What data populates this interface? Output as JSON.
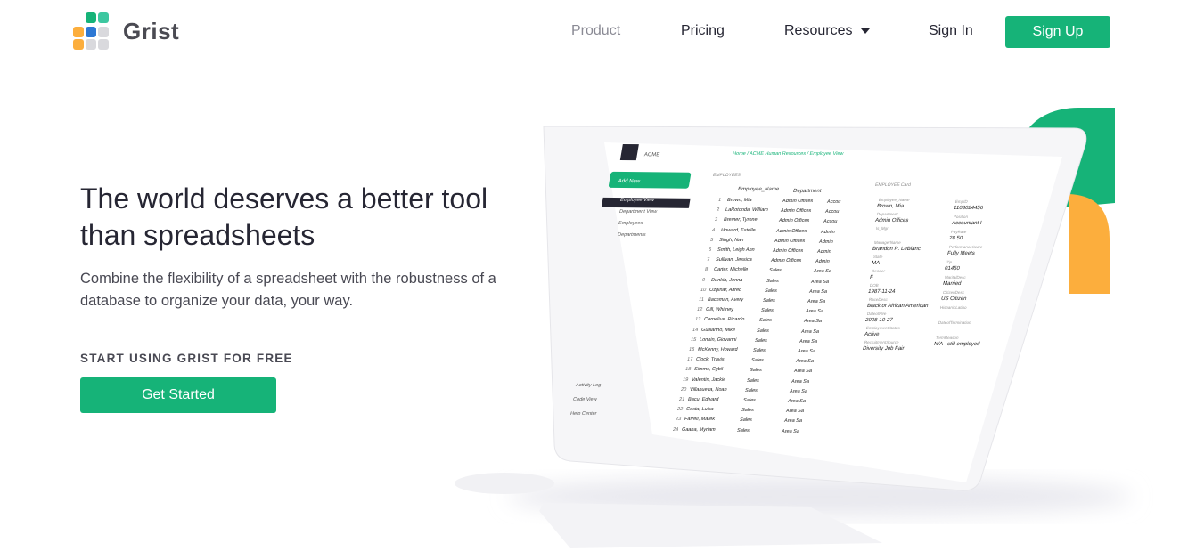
{
  "nav": {
    "logo_text": "Grist",
    "links": [
      {
        "label": "Product"
      },
      {
        "label": "Pricing"
      },
      {
        "label": "Resources"
      },
      {
        "label": "Sign In"
      }
    ],
    "signup_label": "Sign Up"
  },
  "hero": {
    "title": "The world deserves a better tool than spreadsheets",
    "subtitle": "Combine the flexibility of a spreadsheet with the robustness of a database to organize your data, your way.",
    "cta_label": "START USING GRIST FOR FREE",
    "cta_button": "Get Started"
  },
  "mockup": {
    "org": "ACME",
    "add_new": "Add New",
    "breadcrumb": "Home / ACME Human Resources / Employee View",
    "pages": [
      "Employee View",
      "Department View",
      "Employees",
      "Departments"
    ],
    "tools": [
      "Activity Log",
      "Code View",
      "Help Center"
    ],
    "table_title": "EMPLOYEES",
    "card_title": "EMPLOYEE Card",
    "columns": [
      "Employee_Name",
      "Department"
    ],
    "rows": [
      {
        "n": "1",
        "name": "Brown, Mia",
        "dept": "Admin Offices",
        "x": "Accou"
      },
      {
        "n": "2",
        "name": "LaRotonda, William",
        "dept": "Admin Offices",
        "x": "Accou"
      },
      {
        "n": "3",
        "name": "Bremer, Tyrone",
        "dept": "Admin Offices",
        "x": "Accou"
      },
      {
        "n": "4",
        "name": "Howard, Estelle",
        "dept": "Admin Offices",
        "x": "Admin"
      },
      {
        "n": "5",
        "name": "Singh, Nan",
        "dept": "Admin Offices",
        "x": "Admin"
      },
      {
        "n": "6",
        "name": "Smith, Leigh Ann",
        "dept": "Admin Offices",
        "x": "Admin"
      },
      {
        "n": "7",
        "name": "Sullivan, Jessica",
        "dept": "Admin Offices",
        "x": "Admin"
      },
      {
        "n": "8",
        "name": "Carter, Michelle",
        "dept": "Sales",
        "x": "Area Sa"
      },
      {
        "n": "9",
        "name": "Dunkin, Jenna",
        "dept": "Sales",
        "x": "Area Sa"
      },
      {
        "n": "10",
        "name": "Ozpinar, Alfred",
        "dept": "Sales",
        "x": "Area Sa"
      },
      {
        "n": "11",
        "name": "Bachman, Avery",
        "dept": "Sales",
        "x": "Area Sa"
      },
      {
        "n": "12",
        "name": "Gill, Whitney",
        "dept": "Sales",
        "x": "Area Sa"
      },
      {
        "n": "13",
        "name": "Cornelius, Ricardo",
        "dept": "Sales",
        "x": "Area Sa"
      },
      {
        "n": "14",
        "name": "Guilianno, Mike",
        "dept": "Sales",
        "x": "Area Sa"
      },
      {
        "n": "15",
        "name": "Lonnin, Giovanni",
        "dept": "Sales",
        "x": "Area Sa"
      },
      {
        "n": "16",
        "name": "McKenny, Howard",
        "dept": "Sales",
        "x": "Area Sa"
      },
      {
        "n": "17",
        "name": "Clock, Travis",
        "dept": "Sales",
        "x": "Area Sa"
      },
      {
        "n": "18",
        "name": "Simms, Cybil",
        "dept": "Sales",
        "x": "Area Sa"
      },
      {
        "n": "19",
        "name": "Valentin, Jackie",
        "dept": "Sales",
        "x": "Area Sa"
      },
      {
        "n": "20",
        "name": "Villanueva, Noah",
        "dept": "Sales",
        "x": "Area Sa"
      },
      {
        "n": "21",
        "name": "Bacu, Edward",
        "dept": "Sales",
        "x": "Area Sa"
      },
      {
        "n": "22",
        "name": "Costa, Luisa",
        "dept": "Sales",
        "x": "Area Sa"
      },
      {
        "n": "23",
        "name": "Farrell, Marek",
        "dept": "Sales",
        "x": "Area Sa"
      },
      {
        "n": "24",
        "name": "Gaana, Myriam",
        "dept": "Sales",
        "x": "Area Sa"
      }
    ],
    "card_left": [
      {
        "label": "Employee_Name",
        "value": "Brown, Mia"
      },
      {
        "label": "Department",
        "value": "Admin Offices"
      },
      {
        "label": "Is_Mgr",
        "value": ""
      },
      {
        "label": "ManagerName",
        "value": "Brandon R. LeBlanc"
      },
      {
        "label": "State",
        "value": "MA"
      },
      {
        "label": "Gender",
        "value": "F"
      },
      {
        "label": "DOB",
        "value": "1987-11-24"
      },
      {
        "label": "RaceDesc",
        "value": "Black or African American"
      },
      {
        "label": "DateofHire",
        "value": "2008-10-27"
      },
      {
        "label": "EmploymentStatus",
        "value": "Active"
      },
      {
        "label": "RecruitmentSource",
        "value": "Diversity Job Fair"
      }
    ],
    "card_right": [
      {
        "label": "EmpID",
        "value": "1103024456"
      },
      {
        "label": "Position",
        "value": "Accountant I"
      },
      {
        "label": "PayRate",
        "value": "28.50"
      },
      {
        "label": "PerformanceScore",
        "value": "Fully Meets"
      },
      {
        "label": "Zip",
        "value": "01450"
      },
      {
        "label": "MaritalDesc",
        "value": "Married"
      },
      {
        "label": "CitizenDesc",
        "value": "US Citizen"
      },
      {
        "label": "HispanicLatino",
        "value": ""
      },
      {
        "label": "DateofTermination",
        "value": ""
      },
      {
        "label": "TermReason",
        "value": "N/A - still employed"
      }
    ]
  }
}
